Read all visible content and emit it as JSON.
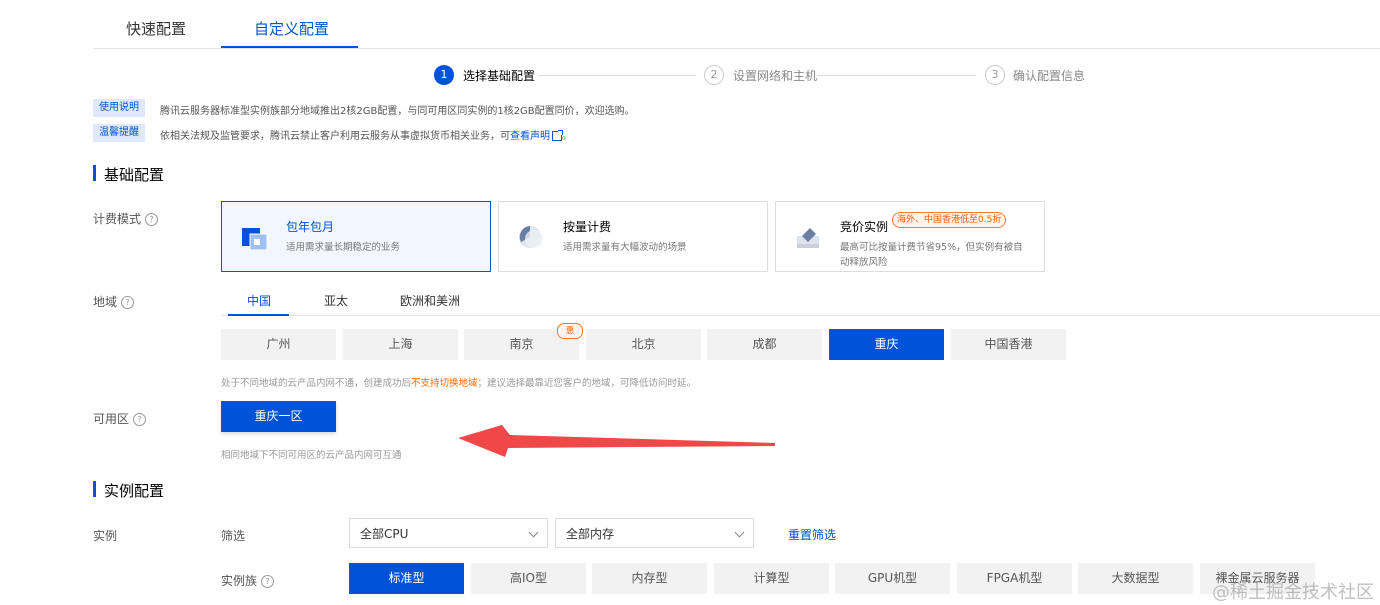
{
  "tabs": {
    "quick": "快速配置",
    "custom": "自定义配置"
  },
  "steps": [
    {
      "num": "1",
      "label": "选择基础配置"
    },
    {
      "num": "2",
      "label": "设置网络和主机"
    },
    {
      "num": "3",
      "label": "确认配置信息"
    }
  ],
  "notices": {
    "usage_tag": "使用说明",
    "usage_text": "腾讯云服务器标准型实例族部分地域推出2核2GB配置，与同可用区同实例的1核2GB配置同价，欢迎选购。",
    "warn_tag": "温馨提醒",
    "warn_text": "依相关法规及监管要求，腾讯云禁止客户利用云服务从事虚拟货币相关业务，可",
    "warn_link": "查看声明",
    "warn_end": "。"
  },
  "basic_section": {
    "title": "基础配置"
  },
  "billing": {
    "label": "计费模式",
    "options": [
      {
        "title": "包年包月",
        "desc": "适用需求量长期稳定的业务"
      },
      {
        "title": "按量计费",
        "desc": "适用需求量有大幅波动的场景"
      },
      {
        "title": "竞价实例",
        "badge": "海外、中国香港低至0.5折",
        "desc1": "最高可比按量计费节省95%，但实例有被自",
        "desc2": "动释放风险"
      }
    ]
  },
  "region": {
    "label": "地域",
    "tabs": [
      "中国",
      "亚太",
      "欧洲和美洲"
    ],
    "cities": [
      "广州",
      "上海",
      "南京",
      "北京",
      "成都",
      "重庆",
      "中国香港"
    ],
    "hui_badge": "惠",
    "hint_pre": "处于不同地域的云产品内网不通，创建成功后",
    "hint_warn": "不支持切换地域",
    "hint_post": "；建议选择最靠近您客户的地域，可降低访问时延。"
  },
  "zone": {
    "label": "可用区",
    "selected": "重庆一区",
    "hint": "相同地域下不同可用区的云产品内网可互通"
  },
  "instance_section": {
    "title": "实例配置"
  },
  "instance": {
    "label": "实例",
    "filter_label": "筛选",
    "cpu_select": "全部CPU",
    "mem_select": "全部内存",
    "reset": "重置筛选",
    "family_label": "实例族",
    "families": [
      "标准型",
      "高IO型",
      "内存型",
      "计算型",
      "GPU机型",
      "FPGA机型",
      "大数据型",
      "裸金属云服务器"
    ]
  },
  "watermark": "@稀土掘金技术社区",
  "colors": {
    "accent": "#0052d9",
    "arrow": "#f04848",
    "promo": "#ff5a00"
  }
}
